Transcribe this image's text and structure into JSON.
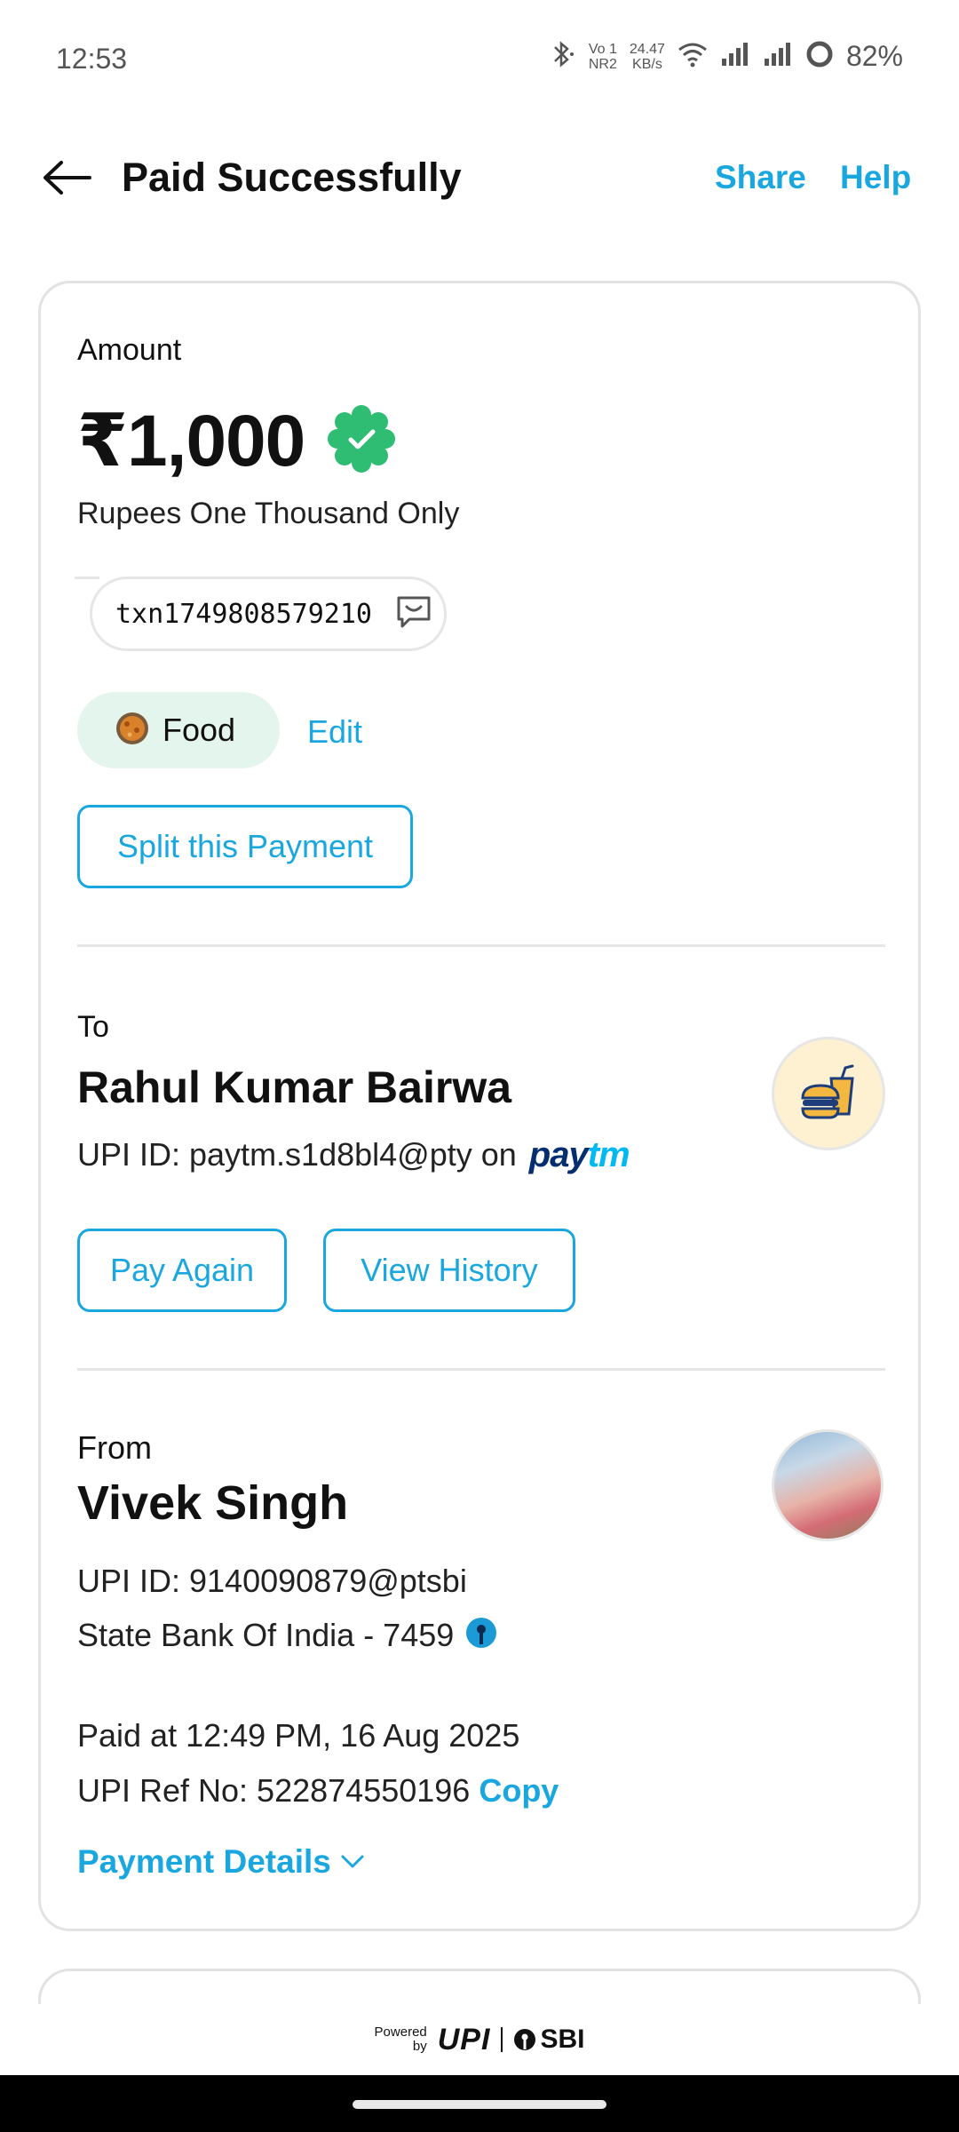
{
  "status_bar": {
    "time": "12:53",
    "volte_top": "Vo 1",
    "volte_bottom": "NR2",
    "speed_top": "24.47",
    "speed_bottom": "KB/s",
    "battery": "82%"
  },
  "header": {
    "title": "Paid Successfully",
    "share_label": "Share",
    "help_label": "Help"
  },
  "payment": {
    "amount_label": "Amount",
    "amount": "₹1,000",
    "amount_words": "Rupees One Thousand Only",
    "transaction_note": "txn1749808579210",
    "category": "Food",
    "edit_label": "Edit",
    "split_label": "Split this Payment"
  },
  "to": {
    "label": "To",
    "name": "Rahul Kumar Bairwa",
    "upi_prefix": "UPI ID: paytm.s1d8bl4@pty on",
    "provider": "paytm",
    "pay_again_label": "Pay Again",
    "view_history_label": "View History"
  },
  "from": {
    "label": "From",
    "name": "Vivek Singh",
    "upi_id": "UPI ID: 9140090879@ptsbi",
    "bank": "State Bank Of India - 7459"
  },
  "details": {
    "paid_at": "Paid at 12:49 PM, 16 Aug 2025",
    "ref_no": "UPI Ref No: 522874550196",
    "copy_label": "Copy",
    "payment_details_label": "Payment Details"
  },
  "footer": {
    "powered_top": "Powered",
    "powered_bottom": "by",
    "upi_logo": "UPI",
    "bank_logo": "SBI"
  },
  "colors": {
    "accent": "#1aa7df",
    "success": "#2ebd72",
    "chip_bg": "#e3f5ec",
    "paytm_dark": "#042e6f",
    "paytm_light": "#00b9f1"
  }
}
